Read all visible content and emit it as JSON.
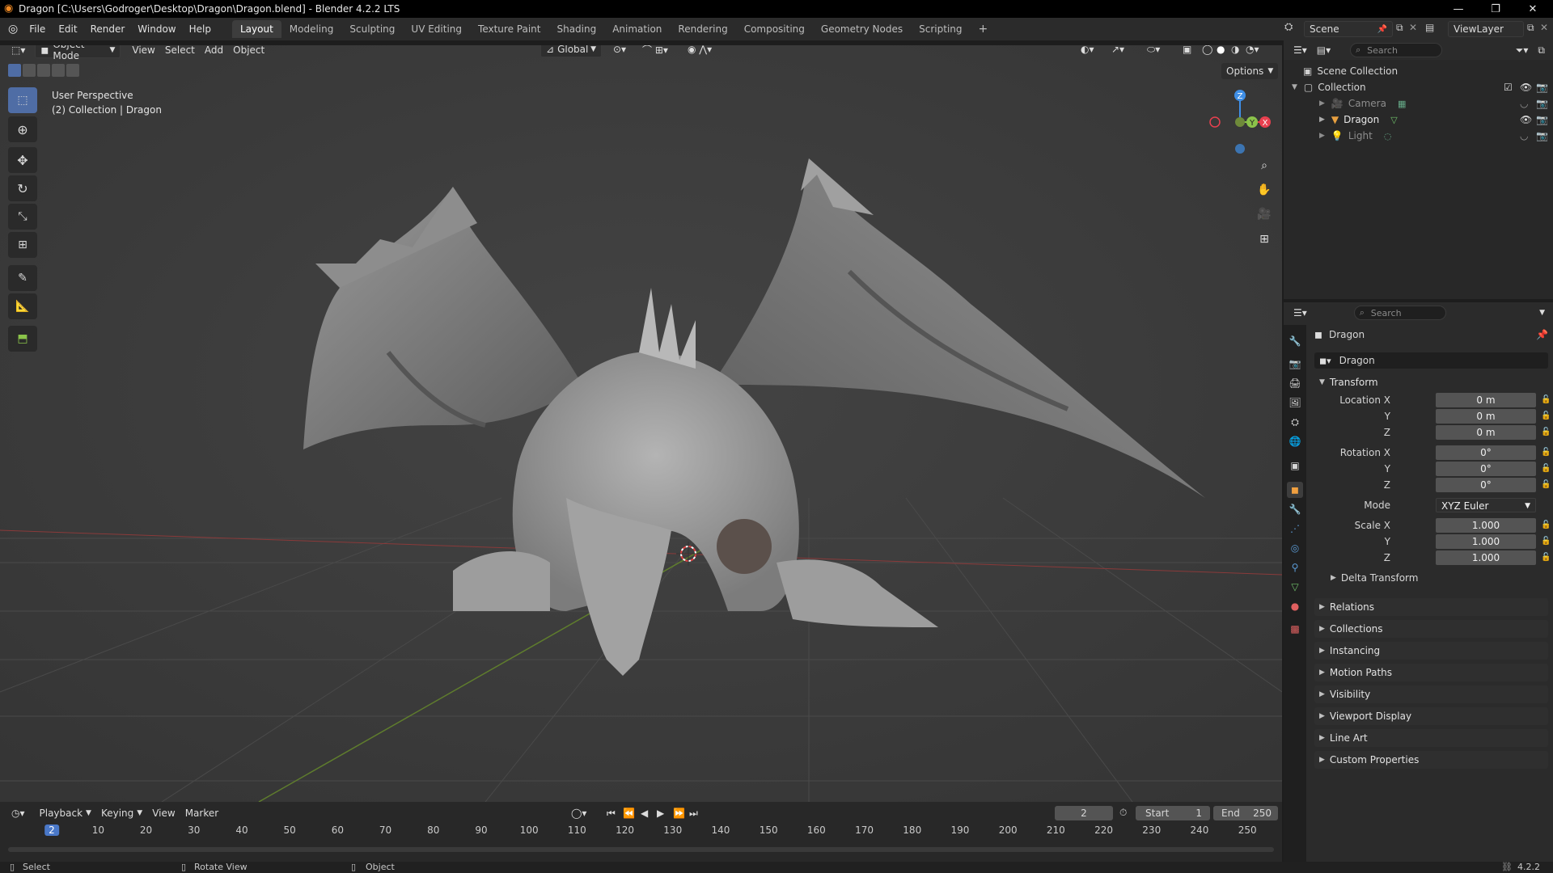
{
  "window": {
    "title": "Dragon [C:\\Users\\Godroger\\Desktop\\Dragon\\Dragon.blend] - Blender 4.2.2 LTS",
    "minimize": "—",
    "restore": "❐",
    "close": "✕"
  },
  "menus": [
    "File",
    "Edit",
    "Render",
    "Window",
    "Help"
  ],
  "workspaces": [
    "Layout",
    "Modeling",
    "Sculpting",
    "UV Editing",
    "Texture Paint",
    "Shading",
    "Animation",
    "Rendering",
    "Compositing",
    "Geometry Nodes",
    "Scripting"
  ],
  "workspace_add": "+",
  "scene": {
    "name": "Scene",
    "view_layer": "ViewLayer"
  },
  "viewport": {
    "mode": "Object Mode",
    "menus": [
      "View",
      "Select",
      "Add",
      "Object"
    ],
    "orientation": "Global",
    "options_label": "Options",
    "overlay_line1": "User Perspective",
    "overlay_line2": "(2) Collection | Dragon",
    "gizmo": {
      "z": "Z",
      "y": "Y",
      "x": "X"
    }
  },
  "outliner": {
    "search_placeholder": "Search",
    "scene_collection": "Scene Collection",
    "collection": "Collection",
    "items": [
      "Camera",
      "Dragon",
      "Light"
    ]
  },
  "properties": {
    "search_placeholder": "Search",
    "object_name": "Dragon",
    "datablock_name": "Dragon",
    "transform_title": "Transform",
    "location_label": "Location X",
    "rotation_label": "Rotation X",
    "scale_label": "Scale X",
    "axis_y": "Y",
    "axis_z": "Z",
    "location": [
      "0 m",
      "0 m",
      "0 m"
    ],
    "rotation": [
      "0°",
      "0°",
      "0°"
    ],
    "mode_label": "Mode",
    "mode_value": "XYZ Euler",
    "scale": [
      "1.000",
      "1.000",
      "1.000"
    ],
    "delta_transform": "Delta Transform",
    "panels": [
      "Relations",
      "Collections",
      "Instancing",
      "Motion Paths",
      "Visibility",
      "Viewport Display",
      "Line Art",
      "Custom Properties"
    ]
  },
  "timeline": {
    "menus": [
      "Playback",
      "Keying",
      "View",
      "Marker"
    ],
    "current_frame": "2",
    "start_label": "Start",
    "start_value": "1",
    "end_label": "End",
    "end_value": "250",
    "ticks": [
      "2",
      "10",
      "20",
      "30",
      "40",
      "50",
      "60",
      "70",
      "80",
      "90",
      "100",
      "110",
      "120",
      "130",
      "140",
      "150",
      "160",
      "170",
      "180",
      "190",
      "200",
      "210",
      "220",
      "230",
      "240",
      "250"
    ]
  },
  "status": {
    "select": "Select",
    "rotate": "Rotate View",
    "object": "Object",
    "version": "4.2.2"
  },
  "colors": {
    "accent": "#4f6da5",
    "x_axis": "#e8404f",
    "y_axis": "#8bc34a",
    "z_axis": "#3f8fe6",
    "frame_marker": "#4a78c8"
  }
}
